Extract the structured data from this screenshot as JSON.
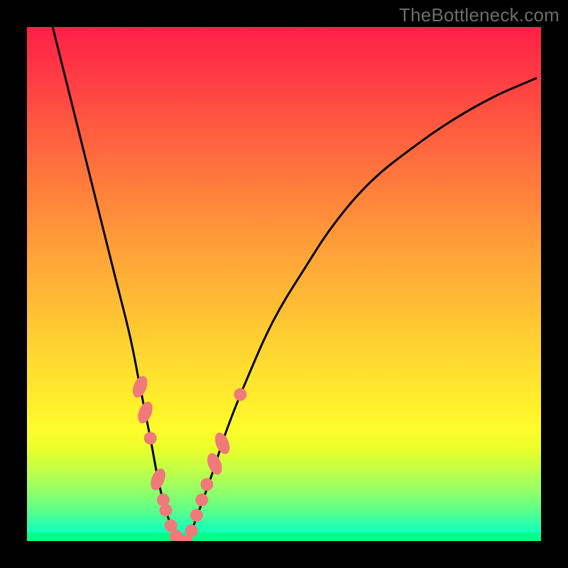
{
  "watermark": "TheBottleneck.com",
  "colors": {
    "frame": "#000000",
    "watermark": "#6d6d6d",
    "curve": "#000000",
    "marker": "#f07a7a",
    "gradient_top": "#ff2046",
    "gradient_bottom": "#00ffcc",
    "green_band": "#00ff87"
  },
  "chart_data": {
    "type": "line",
    "title": "",
    "xlabel": "",
    "ylabel": "",
    "xlim": [
      0,
      100
    ],
    "ylim": [
      0,
      100
    ],
    "series": [
      {
        "name": "bottleneck-curve",
        "x": [
          5,
          8,
          11,
          14,
          17,
          20,
          22,
          24,
          25.5,
          27,
          28.5,
          30,
          31,
          32,
          33.5,
          36,
          39,
          43,
          48,
          54,
          60,
          67,
          75,
          83,
          91,
          99
        ],
        "y": [
          100,
          88,
          76,
          64,
          52,
          40,
          30,
          20,
          12,
          6,
          2,
          0,
          0,
          2,
          6,
          13,
          22,
          32,
          43,
          53,
          62,
          70,
          76.5,
          82,
          86.5,
          90
        ]
      }
    ],
    "markers": [
      {
        "x": 22.0,
        "y": 30.0,
        "shape": "oval"
      },
      {
        "x": 23.0,
        "y": 25.0,
        "shape": "oval"
      },
      {
        "x": 24.0,
        "y": 20.0,
        "shape": "circle"
      },
      {
        "x": 25.5,
        "y": 12.0,
        "shape": "oval"
      },
      {
        "x": 26.5,
        "y": 8.0,
        "shape": "circle"
      },
      {
        "x": 27.0,
        "y": 6.0,
        "shape": "circle"
      },
      {
        "x": 28.0,
        "y": 3.0,
        "shape": "circle"
      },
      {
        "x": 29.0,
        "y": 1.0,
        "shape": "circle"
      },
      {
        "x": 30.0,
        "y": 0.0,
        "shape": "circle"
      },
      {
        "x": 31.0,
        "y": 0.0,
        "shape": "circle"
      },
      {
        "x": 32.0,
        "y": 2.0,
        "shape": "circle"
      },
      {
        "x": 33.0,
        "y": 5.0,
        "shape": "circle"
      },
      {
        "x": 34.0,
        "y": 8.0,
        "shape": "circle"
      },
      {
        "x": 35.0,
        "y": 11.0,
        "shape": "circle"
      },
      {
        "x": 36.5,
        "y": 15.0,
        "shape": "oval"
      },
      {
        "x": 38.0,
        "y": 19.0,
        "shape": "oval"
      },
      {
        "x": 41.5,
        "y": 28.5,
        "shape": "circle"
      }
    ],
    "annotations": []
  }
}
